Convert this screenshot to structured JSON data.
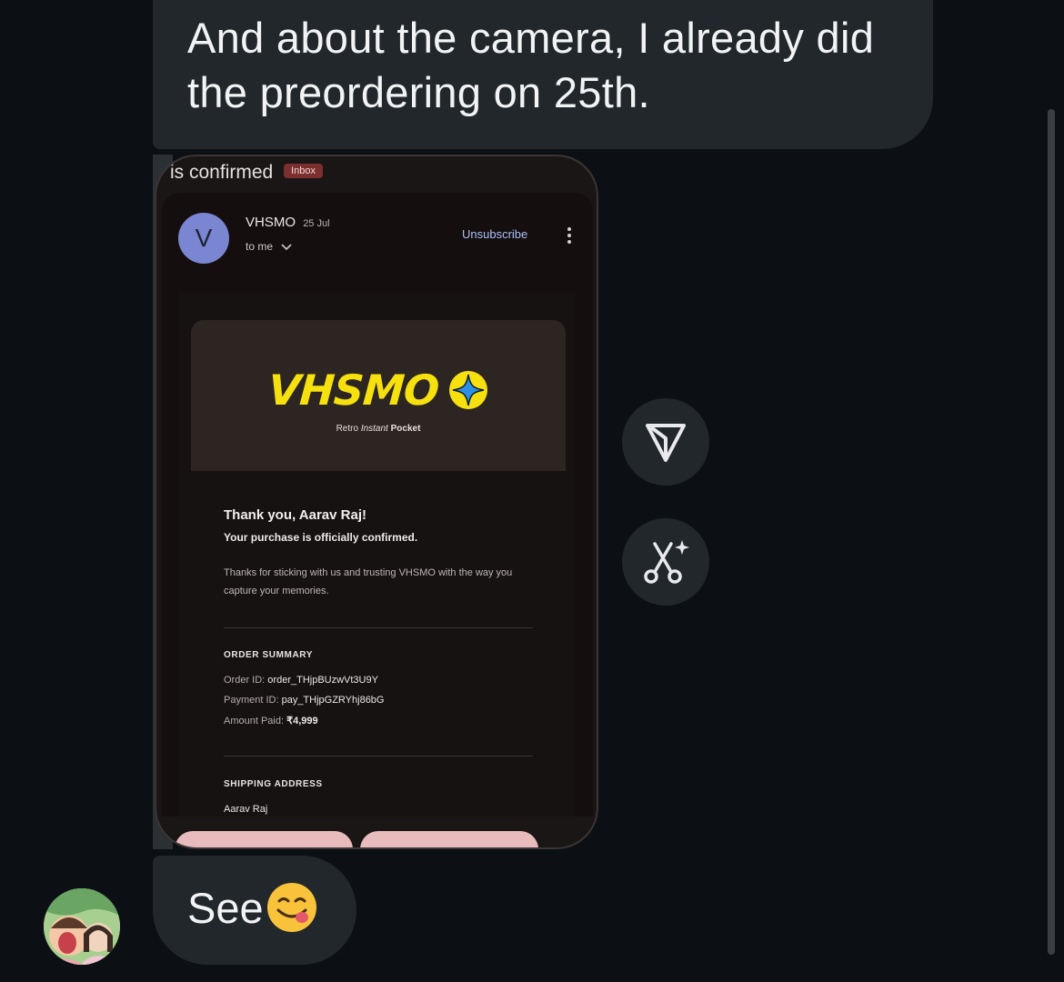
{
  "messages": {
    "top_text": "And about the camera, I already did the preordering on 25th.",
    "see_text": "See"
  },
  "email": {
    "subject_fragment": "is confirmed",
    "label_chip": "Inbox",
    "avatar_letter": "V",
    "sender": "VHSMO",
    "date": "25 Jul",
    "to": "to me",
    "unsubscribe": "Unsubscribe",
    "brand": "VHSMO",
    "tagline_1": "Retro ",
    "tagline_2": "Instant",
    "tagline_3": " Pocket",
    "thanks": "Thank you, Aarav Raj!",
    "confirmed": "Your purchase is officially confirmed.",
    "para": "Thanks for sticking with us and trusting VHSMO with the way you capture your memories.",
    "order_summary_title": "ORDER SUMMARY",
    "order_id_label": "Order ID: ",
    "order_id": "order_THjpBUzwVt3U9Y",
    "payment_id_label": "Payment ID: ",
    "payment_id": "pay_THjpGZRYhj86bG",
    "amount_label": "Amount Paid: ",
    "amount": "₹4,999",
    "shipping_title": "SHIPPING ADDRESS",
    "shipping_name": "Aarav Raj"
  },
  "icons": {
    "forward": "forward-icon",
    "cut": "cut-ai-icon",
    "emoji": "yum-emoji-icon"
  },
  "colors": {
    "background": "#0c1014",
    "bubble": "#22272c",
    "brand_yellow": "#f6e10e",
    "brand_star": "#2e8fe6",
    "link": "#a9c1f7"
  }
}
